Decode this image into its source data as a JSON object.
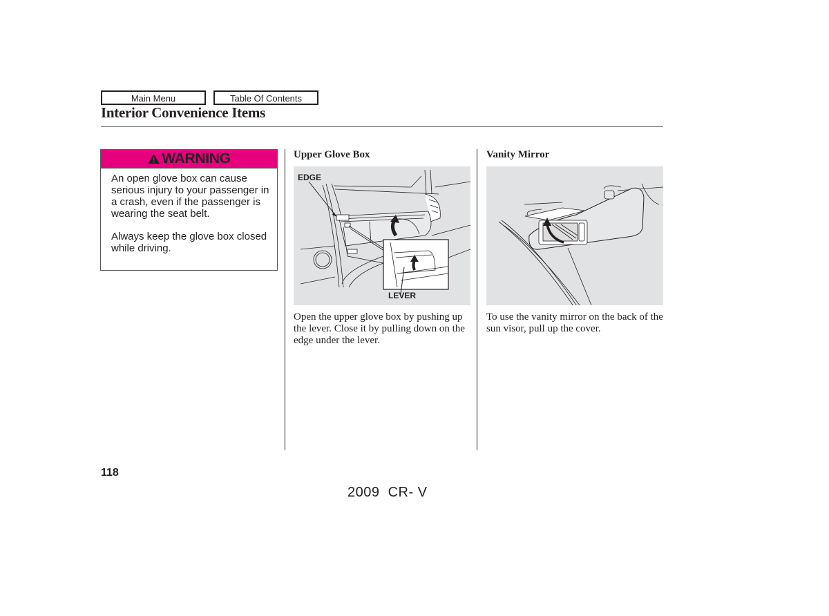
{
  "nav": {
    "main_menu": "Main Menu",
    "table_of_contents": "Table Of Contents"
  },
  "page": {
    "title": "Interior Convenience Items",
    "page_number": "118",
    "footer_model": "2009  CR- V"
  },
  "warning": {
    "icon": "warning-triangle-icon",
    "label": "WARNING",
    "header_color": "#e6007e",
    "paragraphs": [
      "An open glove box can cause serious injury to your passenger in a crash, even if the passenger is wearing the seat belt.",
      "Always keep the glove box closed while driving."
    ]
  },
  "sections": [
    {
      "heading": "Upper Glove Box",
      "figure_labels": {
        "edge": "EDGE",
        "lever": "LEVER"
      },
      "text": "Open the upper glove box by pushing up the lever. Close it by pulling down on the edge under the lever."
    },
    {
      "heading": "Vanity Mirror",
      "text": "To use the vanity mirror on the back of the sun visor, pull up the cover."
    }
  ]
}
